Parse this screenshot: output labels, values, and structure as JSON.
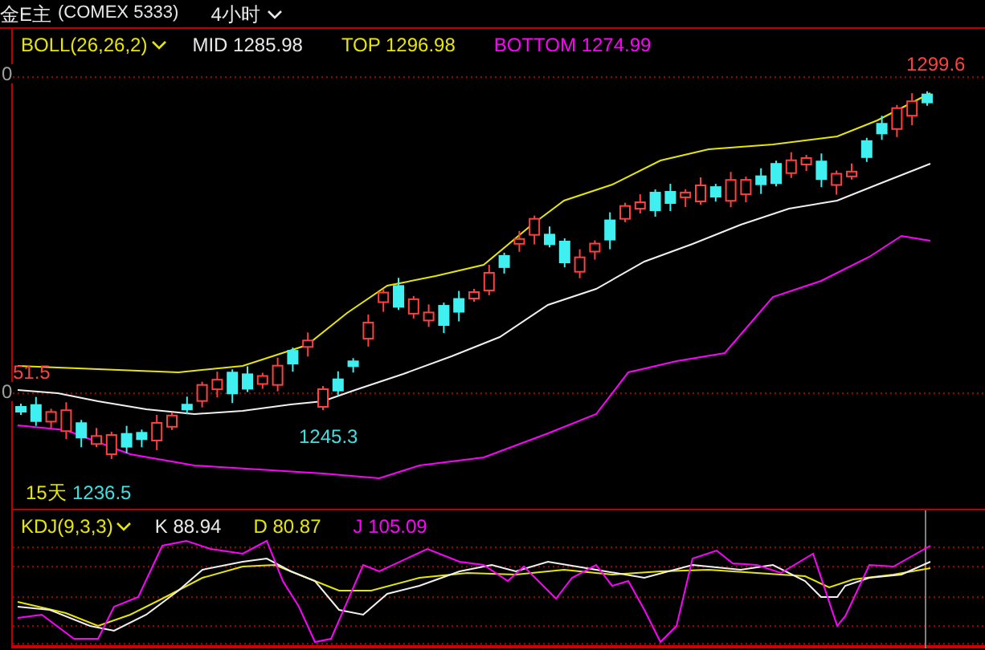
{
  "header": {
    "symbol": "金E主",
    "exchange": "(COMEX 5333)",
    "period": "4小时"
  },
  "main_panel": {
    "indicator": "BOLL(26,26,2)",
    "readings": [
      {
        "text": "MID 1285.98",
        "color": "#e8e8e8"
      },
      {
        "text": "TOP 1296.98",
        "color": "#e6e600"
      },
      {
        "text": "BOTTOM 1274.99",
        "color": "#ff00ff"
      }
    ],
    "labels": [
      {
        "text": "0",
        "kind": "axis"
      },
      {
        "text": "1299.6",
        "kind": "high"
      },
      {
        "text": "51.5",
        "kind": "high"
      },
      {
        "text": "0",
        "kind": "axis"
      },
      {
        "text": "1245.3",
        "kind": "low"
      },
      {
        "text": "15天",
        "kind": "period"
      },
      {
        "text": "1236.5",
        "kind": "low"
      }
    ]
  },
  "kdj_panel": {
    "indicator": "KDJ(9,3,3)",
    "readings": [
      {
        "text": "K 88.94",
        "color": "#e8e8e8"
      },
      {
        "text": "D 80.87",
        "color": "#e6e600"
      },
      {
        "text": "J 105.09",
        "color": "#ff00ff"
      }
    ]
  }
}
